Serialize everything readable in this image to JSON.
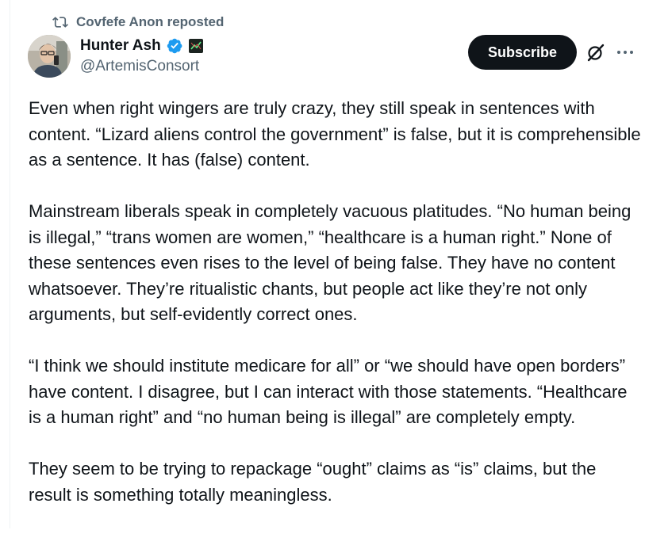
{
  "repost": {
    "label": "Covfefe Anon reposted",
    "icon": "repost-icon"
  },
  "author": {
    "display_name": "Hunter Ash",
    "handle": "@ArtemisConsort",
    "verified_color": "#1d9bf0",
    "affiliation_icon": "chart-badge-icon"
  },
  "actions": {
    "subscribe_label": "Subscribe",
    "grok_icon": "grok-icon",
    "more_icon": "more-icon"
  },
  "tweet": {
    "paragraphs": [
      "Even when right wingers are truly crazy, they still speak in sentences with content. “Lizard aliens control the government” is false, but it is comprehensible as a sentence. It has (false) content.",
      "Mainstream liberals speak in completely vacuous platitudes. “No human being is illegal,” “trans women are women,” “healthcare is a human right.” None of these sentences even rises to the level of being false. They have no content whatsoever. They’re ritualistic chants, but people act like they’re not only arguments, but self-evidently correct ones.",
      "“I think we should institute medicare for all” or “we should have open borders” have content. I disagree, but I can interact with those statements. “Healthcare is a human right” and “no human being is illegal” are completely empty.",
      "They seem to be trying to repackage “ought” claims as “is” claims, but the result is something totally meaningless."
    ]
  },
  "colors": {
    "text": "#0f1419",
    "secondary": "#536471",
    "button_bg": "#0f1419"
  }
}
